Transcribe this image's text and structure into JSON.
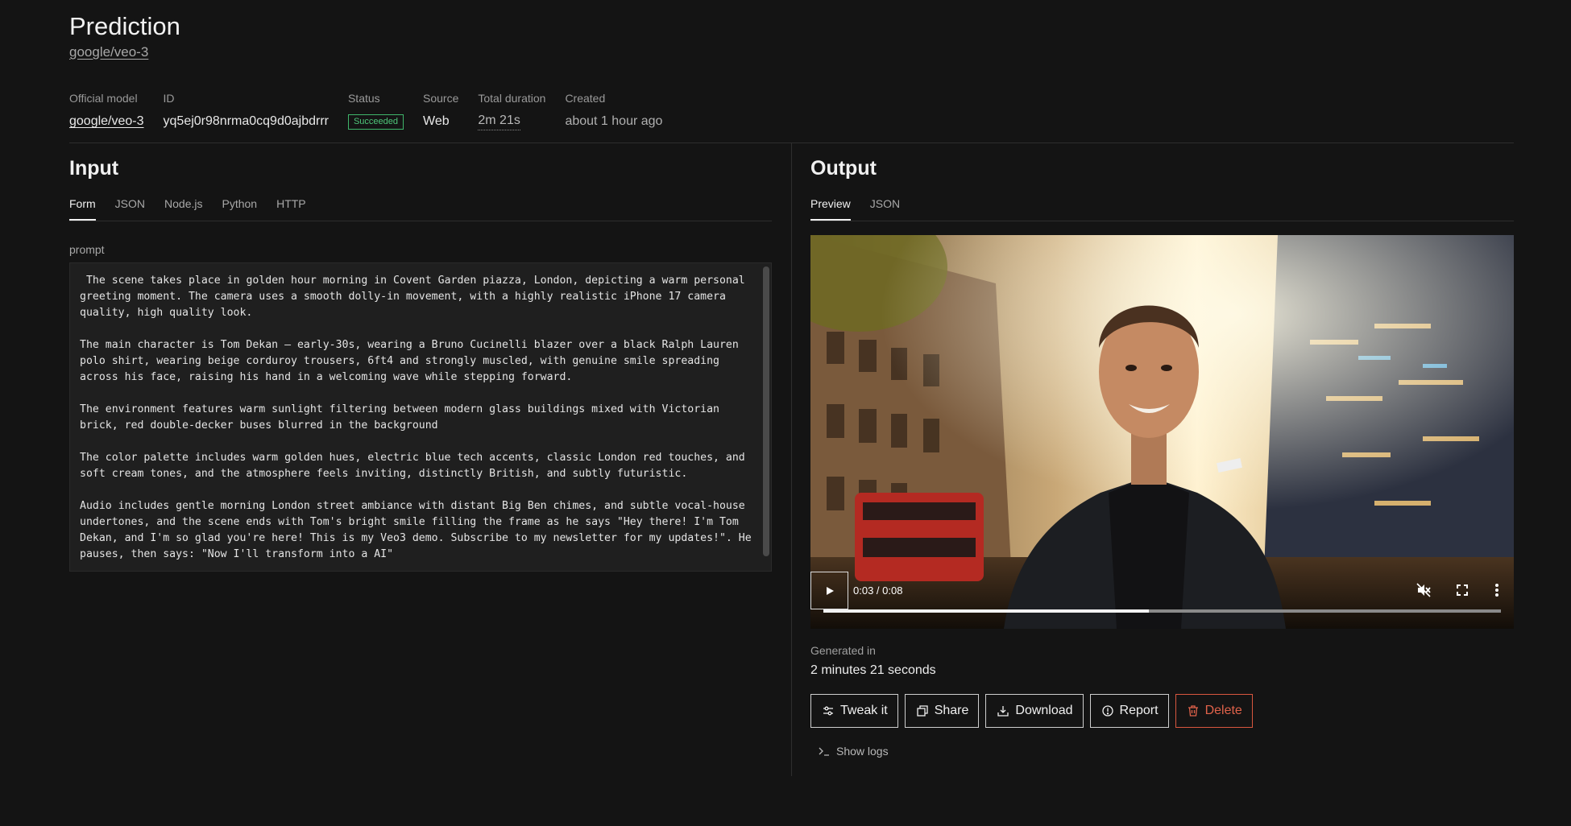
{
  "header": {
    "title": "Prediction",
    "model_link": "google/veo-3"
  },
  "meta": {
    "official_model": {
      "label": "Official model",
      "value": "google/veo-3"
    },
    "id": {
      "label": "ID",
      "value": "yq5ej0r98nrma0cq9d0ajbdrrr"
    },
    "status": {
      "label": "Status",
      "value": "Succeeded",
      "color": "#4fc77a"
    },
    "source": {
      "label": "Source",
      "value": "Web"
    },
    "duration": {
      "label": "Total duration",
      "value": "2m 21s"
    },
    "created": {
      "label": "Created",
      "value": "about 1 hour ago"
    }
  },
  "input": {
    "heading": "Input",
    "tabs": [
      "Form",
      "JSON",
      "Node.js",
      "Python",
      "HTTP"
    ],
    "active_tab": "Form",
    "prompt_label": "prompt",
    "prompt_text": " The scene takes place in golden hour morning in Covent Garden piazza, London, depicting a warm personal greeting moment. The camera uses a smooth dolly-in movement, with a highly realistic iPhone 17 camera quality, high quality look.\n\nThe main character is Tom Dekan — early-30s, wearing a Bruno Cucinelli blazer over a black Ralph Lauren polo shirt, wearing beige corduroy trousers, 6ft4 and strongly muscled, with genuine smile spreading across his face, raising his hand in a welcoming wave while stepping forward.\n\nThe environment features warm sunlight filtering between modern glass buildings mixed with Victorian brick, red double-decker buses blurred in the background\n\nThe color palette includes warm golden hues, electric blue tech accents, classic London red touches, and soft cream tones, and the atmosphere feels inviting, distinctly British, and subtly futuristic.\n\nAudio includes gentle morning London street ambiance with distant Big Ben chimes, and subtle vocal-house undertones, and the scene ends with Tom's bright smile filling the frame as he says \"Hey there! I'm Tom Dekan, and I'm so glad you're here! This is my Veo3 demo. Subscribe to my newsletter for my updates!\". He pauses, then says: \"Now I'll transform into a AI\""
  },
  "output": {
    "heading": "Output",
    "tabs": [
      "Preview",
      "JSON"
    ],
    "active_tab": "Preview",
    "video": {
      "time": "0:03 / 0:08",
      "progress": 0.48
    },
    "generated_label": "Generated in",
    "generated_value": "2 minutes 21 seconds",
    "buttons": {
      "tweak": "Tweak it",
      "share": "Share",
      "download": "Download",
      "report": "Report",
      "delete": "Delete"
    },
    "show_logs": "Show logs"
  },
  "colors": {
    "background": "#141414",
    "danger": "#e0624a",
    "success": "#4fc77a"
  }
}
